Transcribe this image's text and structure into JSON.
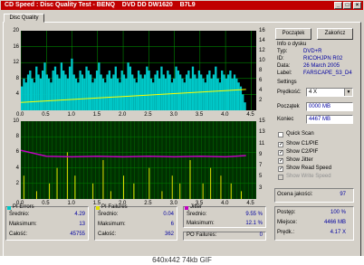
{
  "title": "CD Speed : Disc Quality Test - BENQ    DVD DD DW1620    B7L9",
  "title_buttons": [
    "_",
    "□",
    "×"
  ],
  "tab_label": "Disc Quality",
  "buttons": {
    "start": "Początek",
    "stop": "Zakończ"
  },
  "disc_info": {
    "heading": "Info o dysku",
    "rows": [
      {
        "label": "Typ:",
        "value": "DVD+R"
      },
      {
        "label": "ID:",
        "value": "RICOHJPN R02"
      },
      {
        "label": "Data:",
        "value": "26 March 2005"
      },
      {
        "label": "Label:",
        "value": "FARSCAPE_S3_D4"
      }
    ]
  },
  "settings": {
    "heading": "Settings",
    "speed_label": "Prędkość:",
    "speed_value": "4 X",
    "start_label": "Początek",
    "start_value": "0000 MB",
    "end_label": "Koniec",
    "end_value": "4467 MB"
  },
  "checkboxes": [
    {
      "label": "Quick Scan",
      "checked": false
    },
    {
      "label": "Show C1/PIE",
      "checked": true
    },
    {
      "label": "Show C2/PIF",
      "checked": true
    },
    {
      "label": "Show Jitter",
      "checked": true
    },
    {
      "label": "Show Read Speed",
      "checked": true
    },
    {
      "label": "Show Write Speed",
      "checked": false,
      "disabled": true
    }
  ],
  "quality": {
    "label": "Ocena jakości:",
    "value": "97"
  },
  "progress": {
    "rows": [
      {
        "label": "Postęp:",
        "value": "100 %"
      },
      {
        "label": "Miejsce:",
        "value": "4466 MB"
      },
      {
        "label": "Prędk.:",
        "value": "4.17 X"
      }
    ]
  },
  "stats": {
    "pi_errors": {
      "title": "PI Errors",
      "color": "#00c8c8",
      "rows": [
        {
          "label": "Średnio:",
          "value": "4.29"
        },
        {
          "label": "Maksimum:",
          "value": "13"
        },
        {
          "label": "Całość:",
          "value": "45755"
        }
      ]
    },
    "pi_failures": {
      "title": "PI Failures",
      "color": "#e0e000",
      "rows": [
        {
          "label": "Średnio:",
          "value": "0.04"
        },
        {
          "label": "Maksimum:",
          "value": "6"
        },
        {
          "label": "Całość:",
          "value": "362"
        }
      ]
    },
    "jitter": {
      "title": "Jitter",
      "color": "#c000c0",
      "rows": [
        {
          "label": "Średnio:",
          "value": "9.55 %"
        },
        {
          "label": "Maksimum:",
          "value": "12.1 %"
        }
      ]
    },
    "po_failures": {
      "label": "PO Failures:",
      "value": "0"
    }
  },
  "chart_data": [
    {
      "type": "area",
      "name_note": "PI Errors",
      "x_ticks": [
        "0.0",
        "0.5",
        "1.0",
        "1.5",
        "2.0",
        "2.5",
        "3.0",
        "3.5",
        "4.0",
        "4.5"
      ],
      "y_left_ticks": [
        "20",
        "16",
        "12",
        "8",
        "4"
      ],
      "y_right_ticks": [
        "16",
        "14",
        "12",
        "10",
        "8",
        "6",
        "4",
        "2"
      ],
      "xlim": [
        0,
        4.6
      ],
      "ylim": [
        0,
        20
      ],
      "colors": {
        "bars": "#00c8c8",
        "speed": "#ffff00",
        "grid": "#00a000",
        "bg": "#000000"
      },
      "pi_errors": [
        6,
        8,
        7,
        9,
        10,
        8,
        7,
        11,
        9,
        8,
        10,
        12,
        9,
        8,
        7,
        10,
        11,
        9,
        8,
        12,
        10,
        9,
        8,
        11,
        13,
        9,
        8,
        7,
        10,
        9,
        8,
        11,
        10,
        9,
        7,
        8,
        10,
        12,
        9,
        8,
        7,
        9,
        10,
        8,
        9,
        11,
        8,
        7,
        10,
        9,
        8,
        12,
        11,
        9,
        8,
        7,
        10,
        9,
        8,
        9,
        11,
        10,
        8,
        7,
        9,
        10,
        8,
        11,
        9,
        8,
        10,
        9,
        7,
        8,
        11,
        10,
        9,
        8,
        7,
        9,
        10,
        8,
        11,
        9,
        8,
        10,
        9,
        8,
        7,
        9,
        10,
        8,
        9,
        11,
        8,
        7,
        10,
        9,
        8,
        9,
        10,
        8,
        9,
        8,
        7,
        6,
        4,
        2
      ],
      "read_speed": [
        [
          0.0,
          1.6
        ],
        [
          4.4,
          4.2
        ]
      ]
    },
    {
      "type": "bar",
      "name_note": "PI Failures",
      "x_ticks": [
        "0.0",
        "0.5",
        "1.0",
        "1.5",
        "2.0",
        "2.5",
        "3.0",
        "3.5",
        "4.0",
        "4.5"
      ],
      "y_left_ticks": [
        "10",
        "8",
        "6",
        "4",
        "2"
      ],
      "y_right_ticks": [
        "15",
        "13",
        "11",
        "9",
        "7",
        "5",
        "3"
      ],
      "xlim": [
        0,
        4.6
      ],
      "ylim": [
        0,
        10
      ],
      "colors": {
        "bars": "#e0e000",
        "jitter": "#c000c0",
        "grid": "#008000",
        "bg": "#003000"
      },
      "pi_failures": [
        [
          0.05,
          3
        ],
        [
          0.3,
          1
        ],
        [
          0.55,
          2
        ],
        [
          0.7,
          4
        ],
        [
          0.9,
          6
        ],
        [
          1.05,
          3
        ],
        [
          1.4,
          2
        ],
        [
          1.6,
          5
        ],
        [
          1.75,
          1
        ],
        [
          2.0,
          3
        ],
        [
          2.2,
          2
        ],
        [
          2.5,
          4
        ],
        [
          2.75,
          1
        ],
        [
          2.95,
          3
        ],
        [
          3.1,
          2
        ],
        [
          3.3,
          5
        ],
        [
          3.55,
          2
        ],
        [
          3.7,
          4
        ],
        [
          3.9,
          3
        ],
        [
          4.1,
          2
        ],
        [
          4.3,
          1
        ]
      ],
      "jitter": [
        [
          0.0,
          10.5
        ],
        [
          0.5,
          9.6
        ],
        [
          1.0,
          9.5
        ],
        [
          1.5,
          9.6
        ],
        [
          2.0,
          9.5
        ],
        [
          2.5,
          9.6
        ],
        [
          3.0,
          9.5
        ],
        [
          3.5,
          9.6
        ],
        [
          4.0,
          9.5
        ],
        [
          4.4,
          9.7
        ]
      ]
    }
  ],
  "caption": "640x442  74kb  GIF"
}
